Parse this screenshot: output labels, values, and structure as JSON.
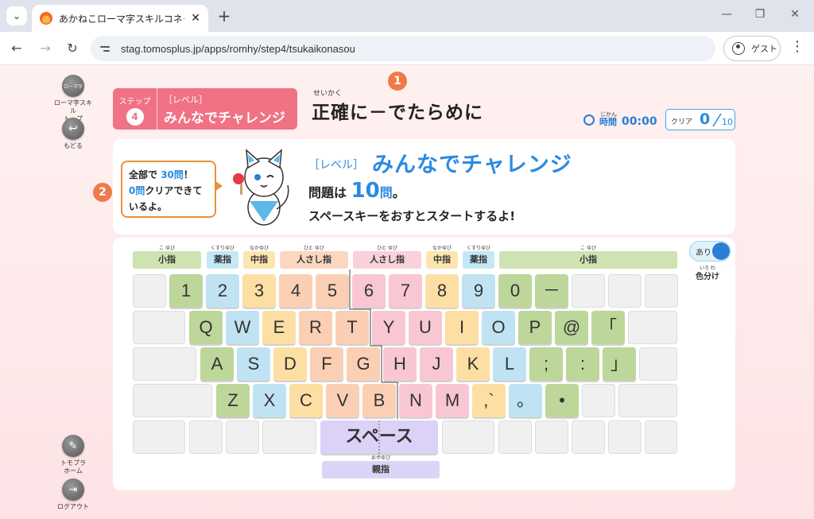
{
  "browser": {
    "tab_title": "あかねこローマ字スキルコネクト タイピ",
    "tab_close": "✕",
    "new_tab": "+",
    "url": "stag.tomosplus.jp/apps/romhy/step4/tsukaikonasou",
    "guest_label": "ゲスト",
    "menu": "⋮",
    "minimize": "—",
    "restore": "❐",
    "close": "✕"
  },
  "sidebar": {
    "items": [
      {
        "icon": "ローマ字",
        "label": "ローマ字スキル\nトップ"
      },
      {
        "icon": "↩",
        "label": "もどる"
      },
      {
        "icon": "✎",
        "label": "トモプラ\nホーム"
      },
      {
        "icon": "⇥",
        "label": "ログアウト"
      }
    ]
  },
  "header": {
    "step_word": "ステップ",
    "step_num": "4",
    "level_label": "［レベル］",
    "level_name": "みんなでチャレンジ",
    "title_ruby": "せいかく",
    "title": "正確に－でたらめに",
    "marker1": "1",
    "marker2": "2",
    "time_ruby": "じかん",
    "time_label": "時間",
    "time_value": "00:00",
    "clear_label": "クリア",
    "clear_value": "0",
    "clear_total": "10"
  },
  "info": {
    "bubble_line1_a": "全部で",
    "bubble_line1_b": "30問",
    "bubble_line1_c": "！",
    "bubble_line2_a": "0問",
    "bubble_line2_b": "クリアできて",
    "bubble_line3": "いるよ。",
    "lv_label": "［レベル］",
    "lv_name": "みんなでチャレンジ",
    "q_prefix": "問題は",
    "q_num": "10",
    "q_unit": "問",
    "q_suffix": "。",
    "instruction": "スペースキーをおすとスタートするよ!"
  },
  "fingers": [
    {
      "ruby": "こ ゆび",
      "name": "小指",
      "color": "green"
    },
    {
      "ruby": "くすりゆび",
      "name": "薬指",
      "color": "blue"
    },
    {
      "ruby": "なかゆび",
      "name": "中指",
      "color": "yellow"
    },
    {
      "ruby": "ひと ゆび",
      "name": "人さし指",
      "color": "orange"
    },
    {
      "ruby": "ひと ゆび",
      "name": "人さし指",
      "color": "pink"
    },
    {
      "ruby": "なかゆび",
      "name": "中指",
      "color": "yellow"
    },
    {
      "ruby": "くすりゆび",
      "name": "薬指",
      "color": "blue"
    },
    {
      "ruby": "こ ゆび",
      "name": "小指",
      "color": "green"
    },
    {
      "ruby": "おやゆび",
      "name": "親指",
      "color": "purple"
    }
  ],
  "keyboard": {
    "row1": [
      "",
      "1",
      "2",
      "3",
      "4",
      "5",
      "6",
      "7",
      "8",
      "9",
      "0",
      "－",
      "",
      "",
      ""
    ],
    "row2": [
      "",
      "Q",
      "W",
      "E",
      "R",
      "T",
      "Y",
      "U",
      "I",
      "O",
      "P",
      "@",
      "「",
      ""
    ],
    "row3": [
      "",
      "A",
      "S",
      "D",
      "F",
      "G",
      "H",
      "J",
      "K",
      "L",
      ";",
      ":",
      "」",
      ""
    ],
    "row4": [
      "",
      "Z",
      "X",
      "C",
      "V",
      "B",
      "N",
      "M",
      ",`",
      "。",
      "•",
      "",
      ""
    ],
    "space": "スペース"
  },
  "toggle": {
    "state": "あり",
    "ruby": "いろ わ",
    "label": "色分け",
    "color": "#2a7fd4"
  },
  "colors": {
    "accent_pink": "#f07284",
    "accent_blue": "#2a8ae0",
    "marker_orange": "#f07a49"
  }
}
